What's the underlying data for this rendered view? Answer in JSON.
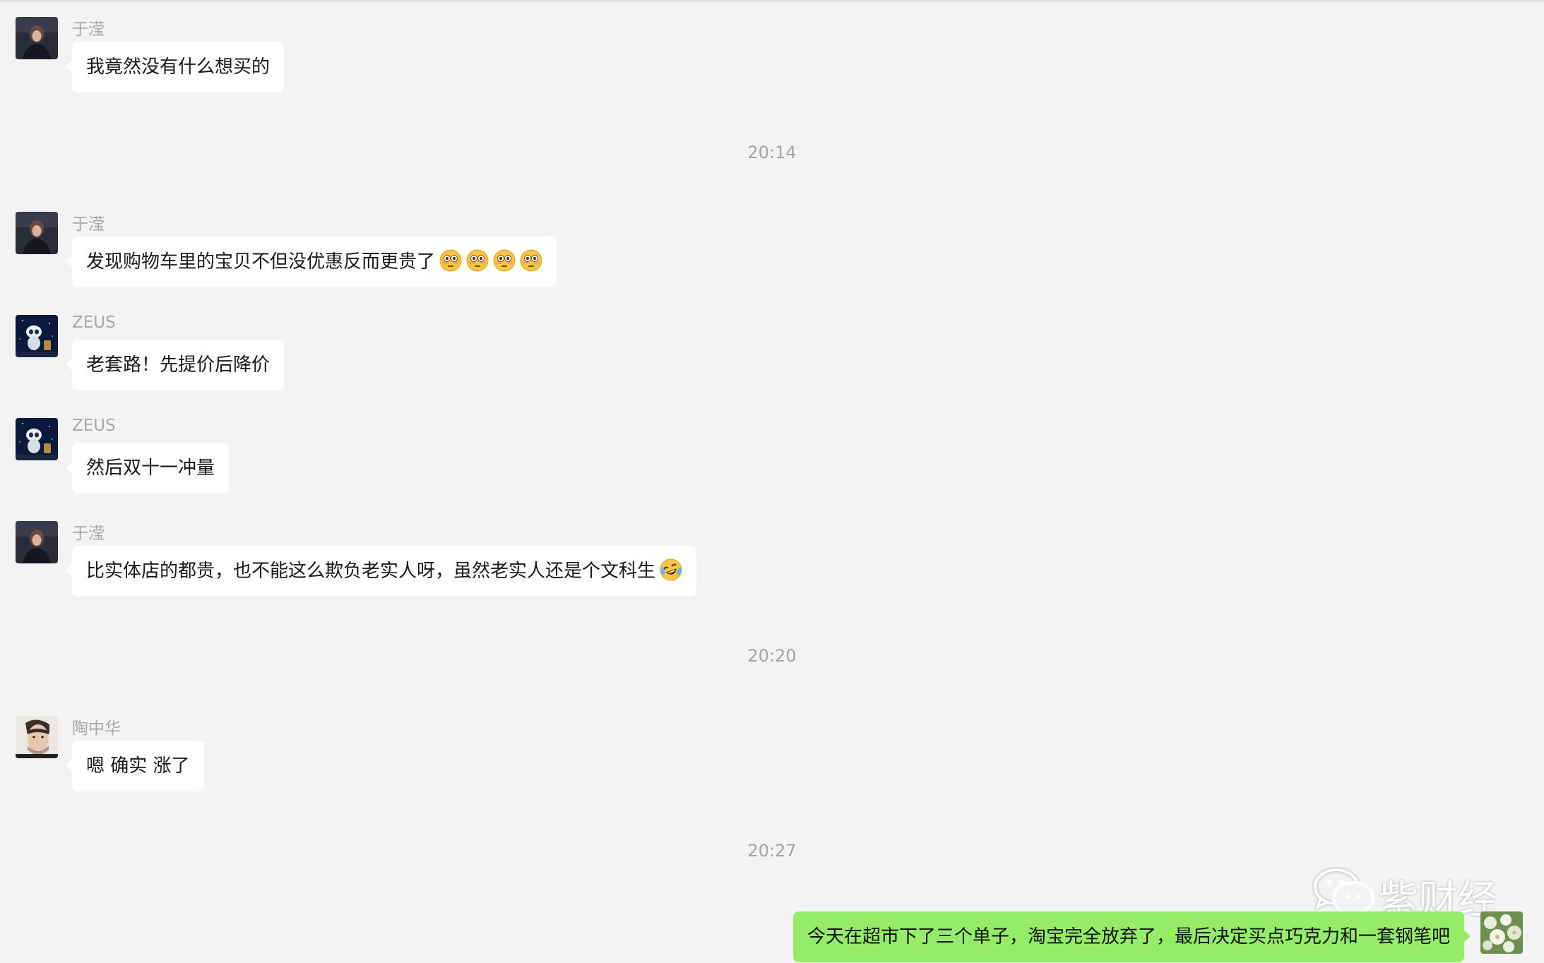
{
  "messages": [
    {
      "sender": "于滢",
      "text": "我竟然没有什么想买的",
      "avatar": "woman-portrait"
    },
    {
      "sender": "于滢",
      "text": "发现购物车里的宝贝不但没优惠反而更贵了",
      "emoji_count": 4,
      "emoji": "flushed-face-emoji",
      "avatar": "woman-portrait"
    },
    {
      "sender": "ZEUS",
      "text": "老套路！先提价后降价",
      "avatar": "robot-space"
    },
    {
      "sender": "ZEUS",
      "text": "然后双十一冲量",
      "avatar": "robot-space"
    },
    {
      "sender": "于滢",
      "text": "比实体店的都贵，也不能这么欺负老实人呀，虽然老实人还是个文科生",
      "emoji": "crying-laughing-emoji",
      "avatar": "woman-portrait"
    },
    {
      "sender": "陶中华",
      "text": "嗯 确实 涨了",
      "avatar": "man-portrait"
    }
  ],
  "timestamps": [
    "20:14",
    "20:20",
    "20:27"
  ],
  "own_message": {
    "text": "今天在超市下了三个单子，淘宝完全放弃了，最后决定买点巧克力和一套钢笔吧",
    "avatar": "flower-photo"
  },
  "watermark": {
    "text": "紫财经",
    "icon": "wechat-logo"
  },
  "colors": {
    "background": "#f3f3f3",
    "incoming_bubble": "#ffffff",
    "outgoing_bubble": "#95ec69",
    "meta_text": "#a8a8a8"
  }
}
